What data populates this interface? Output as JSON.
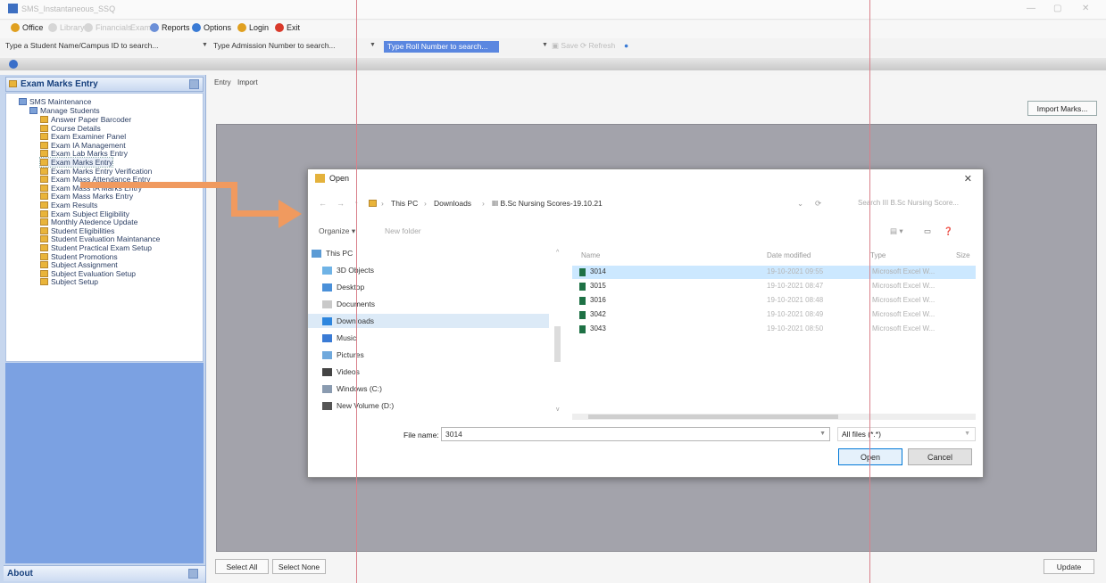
{
  "title_bar": {
    "app_title": "SMS_Instantaneous_SSQ"
  },
  "menu": [
    {
      "label": "Office",
      "enabled": true,
      "icon": "office-icon",
      "color": "#e0a020"
    },
    {
      "label": "Library",
      "enabled": false,
      "icon": "library-icon",
      "color": "#c9c9c9"
    },
    {
      "label": "Financials",
      "enabled": false,
      "icon": "financials-icon",
      "color": "#c9c9c9"
    },
    {
      "label": "Exam",
      "enabled": false,
      "icon": "exam-icon",
      "color": "#c9c9c9"
    },
    {
      "label": "Reports",
      "enabled": true,
      "icon": "reports-icon",
      "color": "#6b8fd8"
    },
    {
      "label": "Options",
      "enabled": true,
      "icon": "options-icon",
      "color": "#3a7bd5"
    },
    {
      "label": "Login",
      "enabled": true,
      "icon": "login-icon",
      "color": "#e0a020"
    },
    {
      "label": "Exit",
      "enabled": true,
      "icon": "exit-icon",
      "color": "#d93a2b"
    }
  ],
  "search": {
    "student_name_placeholder": "Type a Student Name/Campus ID to search...",
    "admission_placeholder": "Type Admission Number to search...",
    "roll_placeholder": "Type Roll Number to search...",
    "save": "Save",
    "refresh": "Refresh"
  },
  "nav": {
    "header": "Exam Marks Entry",
    "root": "SMS Maintenance",
    "group": "Manage Students",
    "items": [
      "Answer Paper Barcoder",
      "Course Details",
      "Exam Examiner Panel",
      "Exam IA Management",
      "Exam Lab Marks Entry",
      "Exam Marks Entry",
      "Exam Marks Entry Verification",
      "Exam Mass Attendance Entry",
      "Exam Mass IA Marks Entry",
      "Exam Mass Marks Entry",
      "Exam Results",
      "Exam Subject Eligibility",
      "Monthly Atedence Update",
      "Student Eligibilities",
      "Student Evaluation Maintanance",
      "Student Practical Exam Setup",
      "Student Promotions",
      "Subject Assignment",
      "Subject Evaluation Setup",
      "Subject Setup"
    ],
    "selected": "Exam Marks Entry",
    "about": "About"
  },
  "main": {
    "tabs": [
      "Entry",
      "Import"
    ],
    "import_button": "Import Marks...",
    "select_all": "Select All",
    "select_none": "Select None",
    "update": "Update"
  },
  "dialog": {
    "title": "Open",
    "breadcrumb": [
      "This PC",
      "Downloads",
      "III B.Sc Nursing Scores-19.10.21"
    ],
    "search_placeholder": "Search III B.Sc Nursing Score...",
    "organize": "Organize",
    "new_folder": "New folder",
    "nav_items": [
      {
        "label": "This PC",
        "icon": "pc-icon",
        "color": "#5b9bd5"
      },
      {
        "label": "3D Objects",
        "icon": "3d-objects-icon",
        "color": "#6fb3e6"
      },
      {
        "label": "Desktop",
        "icon": "desktop-icon",
        "color": "#4a90d9"
      },
      {
        "label": "Documents",
        "icon": "documents-icon",
        "color": "#c9c9c9"
      },
      {
        "label": "Downloads",
        "icon": "downloads-icon",
        "color": "#2e86de"
      },
      {
        "label": "Music",
        "icon": "music-icon",
        "color": "#3a7bd5"
      },
      {
        "label": "Pictures",
        "icon": "pictures-icon",
        "color": "#6fa8dc"
      },
      {
        "label": "Videos",
        "icon": "videos-icon",
        "color": "#444444"
      },
      {
        "label": "Windows (C:)",
        "icon": "drive-icon",
        "color": "#8a9bb0"
      },
      {
        "label": "New Volume (D:)",
        "icon": "drive-icon",
        "color": "#555555"
      }
    ],
    "columns": {
      "name": "Name",
      "date": "Date modified",
      "type": "Type",
      "size": "Size"
    },
    "files": [
      {
        "name": "3014",
        "date": "19-10-2021 09:55",
        "type": "Microsoft Excel W..."
      },
      {
        "name": "3015",
        "date": "19-10-2021 08:47",
        "type": "Microsoft Excel W..."
      },
      {
        "name": "3016",
        "date": "19-10-2021 08:48",
        "type": "Microsoft Excel W..."
      },
      {
        "name": "3042",
        "date": "19-10-2021 08:49",
        "type": "Microsoft Excel W..."
      },
      {
        "name": "3043",
        "date": "19-10-2021 08:50",
        "type": "Microsoft Excel W..."
      }
    ],
    "selected_file": "3014",
    "file_name_label": "File name:",
    "file_name_value": "3014",
    "file_type": "All files (*.*)",
    "open": "Open",
    "cancel": "Cancel"
  }
}
